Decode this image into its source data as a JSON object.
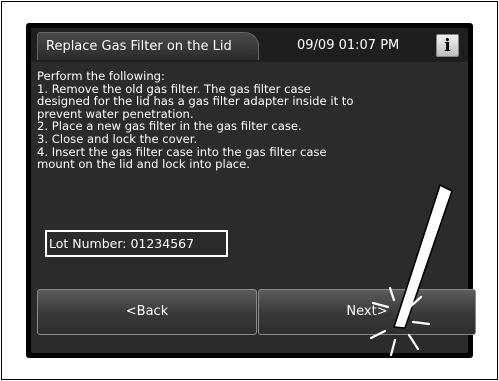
{
  "header": {
    "title": "Replace Gas Filter on the Lid",
    "datetime": "09/09 01:07 PM",
    "info_label": "i"
  },
  "instructions": {
    "lines": [
      "Perform the following:",
      "1. Remove the old gas filter. The gas filter case",
      "designed for the lid has a gas filter adapter inside it to",
      "prevent water penetration.",
      "2. Place a new gas filter in the gas filter case.",
      "3. Close and lock the cover.",
      "4. Insert the gas filter case into the gas filter case",
      "mount on the lid and lock into place."
    ]
  },
  "lot": {
    "label": "Lot Number: 01234567"
  },
  "buttons": {
    "back_label": "<Back",
    "next_label": "Next>"
  },
  "icons": {
    "info": "info-icon",
    "stylus": "stylus-tap-icon"
  },
  "colors": {
    "screen_bg": "#2b2b2b",
    "text": "#ffffff",
    "bezel": "#000000"
  }
}
